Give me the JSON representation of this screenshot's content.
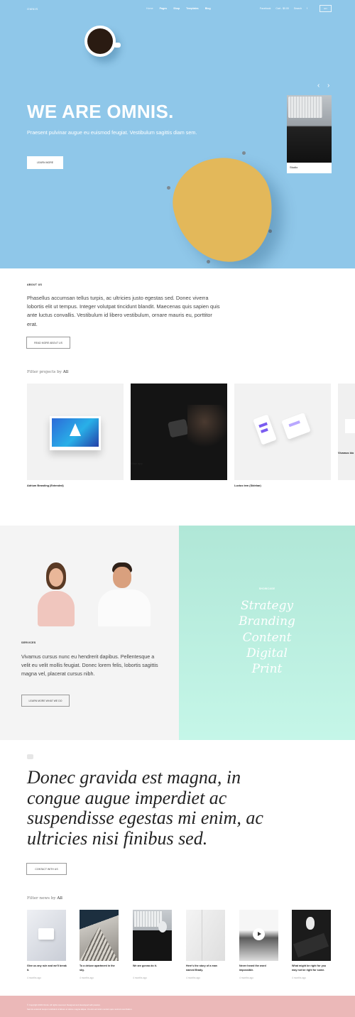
{
  "header": {
    "logo": "OMNIS",
    "nav": [
      "Home",
      "Pages",
      "Shop",
      "Templates",
      "Blog"
    ],
    "nav_right": [
      "Facebook",
      "Cart - $0.00",
      "Search",
      "f"
    ],
    "search_box": "EN"
  },
  "hero": {
    "title": "WE ARE OMNIS.",
    "lead": "Praesent pulvinar augue eu euismod feugiat. Vestibulum sagittis diam sem.",
    "cta": "LEARN MORE",
    "card_label": "Studio",
    "prev_arrow": "‹",
    "next_arrow": "›"
  },
  "about": {
    "label": "ABOUT US",
    "text": "Phasellus accumsan tellus turpis, ac ultricies justo egestas sed. Donec viverra lobortis elit ut tempus. Integer volutpat tincidunt blandit. Maecenas quis sapien quis ante luctus convallis. Vestibulum id libero vestibulum, ornare mauris eu, porttitor erat.",
    "button": "READ MORE ABOUT US"
  },
  "projects": {
    "filter_prefix": "Filter projects by",
    "filter_value": "All",
    "items": [
      {
        "label": "Adrium Branding (Extended)"
      },
      {
        "label": "Vitae app"
      },
      {
        "label": "Luctus tem (Sidebar)"
      },
      {
        "label": "Vivamus bio"
      }
    ]
  },
  "services": {
    "label": "SERVICES",
    "text": "Vivamus cursus nunc eu hendrerit dapibus. Pellentesque a velit eu velit mollis feugiat. Donec lorem felis, lobortis sagittis magna vel, placerat cursus nibh.",
    "button": "LEARN MORE WHAT WE DO"
  },
  "showcase": {
    "label": "SHOWCASE",
    "words": [
      "Strategy",
      "Branding",
      "Content",
      "Digital",
      "Print"
    ]
  },
  "quote": {
    "text": "Donec gravida est magna, in congue augue imperdiet ac suspendisse egestas mi enim, ac ultricies nisi finibus sed.",
    "button": "CONTACT WITH US"
  },
  "news": {
    "filter_prefix": "Filter news by",
    "filter_value": "All",
    "items": [
      {
        "title": "Give us any rule and we'll break it.",
        "time": "4 months ago"
      },
      {
        "title": "To a deluxe apartment in the sky.",
        "time": "4 months ago"
      },
      {
        "title": "We are gonna do it.",
        "time": "4 months ago"
      },
      {
        "title": "Here's the story of a man named Brady.",
        "time": "4 months ago"
      },
      {
        "title": "Never heard the word impossible.",
        "time": "4 months ago"
      },
      {
        "title": "What might be right for you may not be right for some.",
        "time": "4 months ago"
      }
    ]
  },
  "footer": {
    "line1": "© Copyright 2019 Omnis. All rights reserved. Designed and developed with passion.",
    "line2": "Sed do eiusmod tempor incididunt ut labore et dolore magna aliqua. Ut enim ad minim veniam quis nostrud exercitation."
  },
  "colors": {
    "hero_bg": "#8fc7e9",
    "showcase_bg": "#b0e7d7",
    "footer_bg": "#ebb8b8",
    "services_bg": "#f4f4f4"
  }
}
